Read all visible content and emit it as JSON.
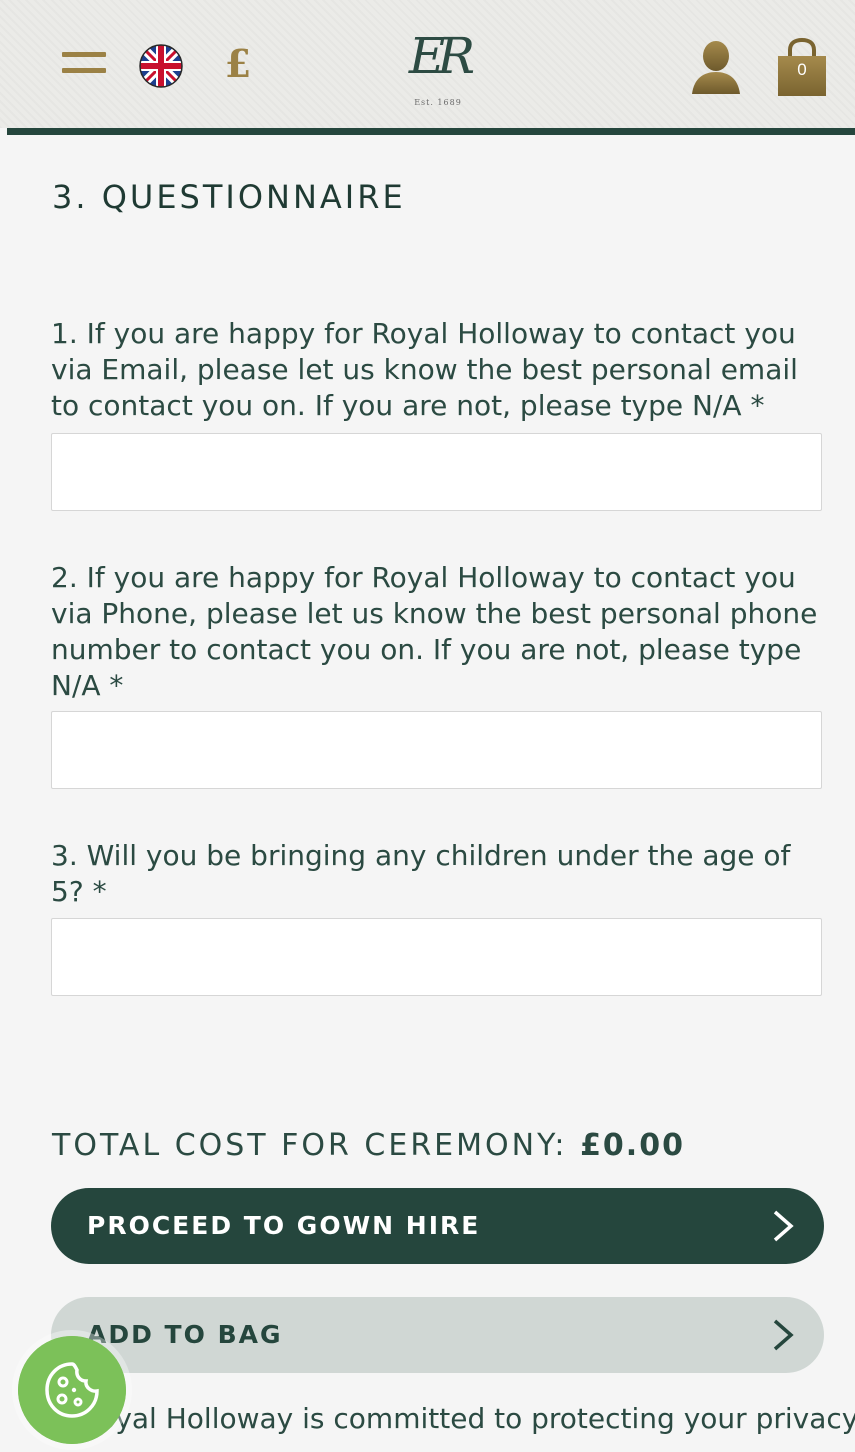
{
  "header": {
    "menu_icon": "hamburger-menu-icon",
    "flag_icon": "uk-flag-icon",
    "currency_symbol": "£",
    "logo": {
      "monogram": "ER",
      "established": "Est. 1689"
    },
    "account_icon": "user-account-icon",
    "bag": {
      "icon": "shopping-bag-icon",
      "count": "0"
    },
    "rule_color": "#25463d",
    "accent_color": "#9b8145"
  },
  "section": {
    "title": "3. QUESTIONNAIRE"
  },
  "questions": [
    {
      "label": "1. If you are happy for Royal Holloway to contact you via Email, please let us know the best personal email to contact you on. If you are not, please type N/A *",
      "value": ""
    },
    {
      "label": "2. If you are happy for Royal Holloway to contact you via Phone, please let us know the best personal phone number to contact you on. If you are not, please type N/A *",
      "value": ""
    },
    {
      "label": "3. Will you be bringing any children under the age of 5? *",
      "value": ""
    }
  ],
  "total": {
    "label": "TOTAL COST FOR CEREMONY:",
    "amount": "£0.00"
  },
  "buttons": {
    "proceed": {
      "label": "PROCEED TO GOWN HIRE",
      "icon": "chevron-right-icon",
      "color": "#25463d"
    },
    "add_to_bag": {
      "label": "ADD TO BAG",
      "icon": "chevron-right-icon",
      "color": "#d0d7d4"
    }
  },
  "footer": {
    "privacy_text": "Royal Holloway is committed to protecting your privacy,"
  },
  "cookie": {
    "icon": "cookie-icon",
    "color": "#7cc159"
  }
}
